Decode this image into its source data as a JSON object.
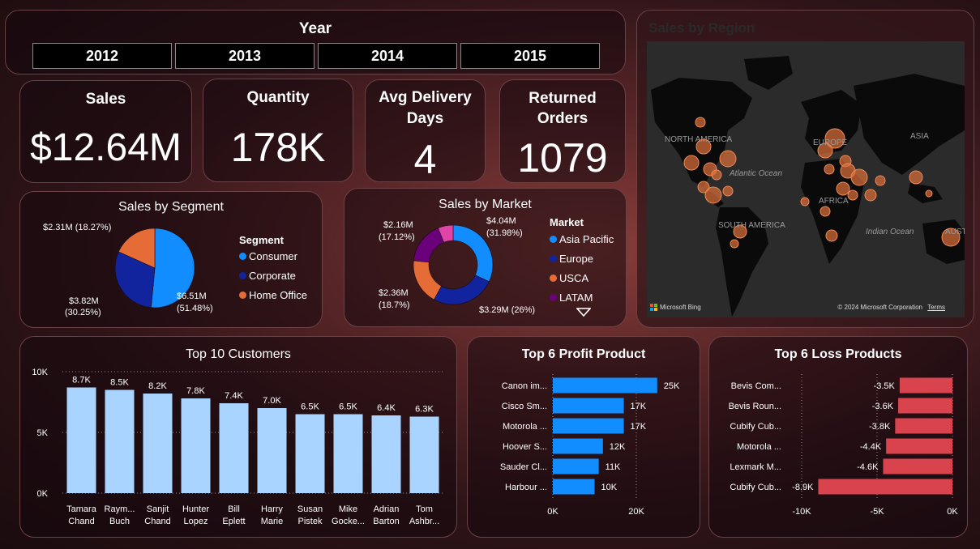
{
  "year_slicer": {
    "title": "Year",
    "years": [
      "2012",
      "2013",
      "2014",
      "2015"
    ]
  },
  "kpis": {
    "sales": {
      "title": "Sales",
      "value": "$12.64M"
    },
    "quantity": {
      "title": "Quantity",
      "value": "178K"
    },
    "avg_delivery": {
      "title_line1": "Avg Delivery",
      "title_line2": "Days",
      "value": "4"
    },
    "returned": {
      "title_line1": "Returned",
      "title_line2": "Orders",
      "value": "1079"
    }
  },
  "map": {
    "title": "Sales by Region",
    "labels": {
      "north_america": "NORTH AMERICA",
      "south_america": "SOUTH AMERICA",
      "europe": "EUROPE",
      "asia": "ASIA",
      "africa": "AFRICA",
      "australia": "AUSTRA",
      "atlantic": "Atlantic Ocean",
      "indian": "Indian Ocean"
    },
    "bing": "Microsoft Bing",
    "copyright": "© 2024 Microsoft Corporation",
    "terms": "Terms",
    "bubble_color": "#e0703a"
  },
  "colors": {
    "consumer": "#118dff",
    "corporate": "#12239e",
    "home_office": "#e66c37",
    "latam": "#6b007b",
    "other": "#e044a7",
    "customers_bar": "#a8d4ff",
    "profit_bar": "#118dff",
    "loss_bar": "#d9434e"
  },
  "chart_data": [
    {
      "type": "pie",
      "title": "Sales by Segment",
      "legend_title": "Segment",
      "slices": [
        {
          "name": "Consumer",
          "value": 6.51,
          "label": "$6.51M",
          "pct": "(51.48%)"
        },
        {
          "name": "Corporate",
          "value": 3.82,
          "label": "$3.82M",
          "pct": "(30.25%)"
        },
        {
          "name": "Home Office",
          "value": 2.31,
          "label": "$2.31M (18.27%)"
        }
      ]
    },
    {
      "type": "pie",
      "title": "Sales by Market",
      "legend_title": "Market",
      "legend": [
        "Asia Pacific",
        "Europe",
        "USCA",
        "LATAM"
      ],
      "slices": [
        {
          "value": 31.98,
          "label": "$4.04M",
          "pct": "(31.98%)"
        },
        {
          "value": 26.0,
          "label": "$3.29M (26%)"
        },
        {
          "value": 18.7,
          "label": "$2.36M",
          "pct": "(18.7%)"
        },
        {
          "value": 17.12,
          "label": "$2.16M",
          "pct": "(17.12%)"
        },
        {
          "value": 6.2
        }
      ]
    },
    {
      "type": "bar",
      "title": "Top 10 Customers",
      "categories": [
        "Tamara Chand",
        "Raymond Buch",
        "Sanjit Chand",
        "Hunter Lopez",
        "Bill Eplett",
        "Harry Marie",
        "Susan Pistek",
        "Mike Gockenbach",
        "Adrian Barton",
        "Tom Ashbrook"
      ],
      "category_lines": [
        [
          "Tamara",
          "Chand"
        ],
        [
          "Raym...",
          "Buch"
        ],
        [
          "Sanjit",
          "Chand"
        ],
        [
          "Hunter",
          "Lopez"
        ],
        [
          "Bill",
          "Eplett"
        ],
        [
          "Harry",
          "Marie"
        ],
        [
          "Susan",
          "Pistek"
        ],
        [
          "Mike",
          "Gocke..."
        ],
        [
          "Adrian",
          "Barton"
        ],
        [
          "Tom",
          "Ashbr..."
        ]
      ],
      "values": [
        8.7,
        8.5,
        8.2,
        7.8,
        7.4,
        7.0,
        6.5,
        6.5,
        6.4,
        6.3
      ],
      "labels": [
        "8.7K",
        "8.5K",
        "8.2K",
        "7.8K",
        "7.4K",
        "7.0K",
        "6.5K",
        "6.5K",
        "6.4K",
        "6.3K"
      ],
      "yticks": [
        "0K",
        "5K",
        "10K"
      ],
      "ylim": [
        0,
        10
      ]
    },
    {
      "type": "bar",
      "title": "Top 6 Profit Product",
      "categories": [
        "Canon im...",
        "Cisco Sm...",
        "Motorola ...",
        "Hoover S...",
        "Sauder Cl...",
        "Harbour ..."
      ],
      "values": [
        25,
        17,
        17,
        12,
        11,
        10
      ],
      "labels": [
        "25K",
        "17K",
        "17K",
        "12K",
        "11K",
        "10K"
      ],
      "xticks": [
        "0K",
        "20K"
      ],
      "xlim": [
        0,
        20
      ]
    },
    {
      "type": "bar",
      "title": "Top 6 Loss Products",
      "categories": [
        "Bevis Com...",
        "Bevis Roun...",
        "Cubify Cub...",
        "Motorola ...",
        "Lexmark M...",
        "Cubify Cub..."
      ],
      "values": [
        -3.5,
        -3.6,
        -3.8,
        -4.4,
        -4.6,
        -8.9
      ],
      "labels": [
        "-3.5K",
        "-3.6K",
        "-3.8K",
        "-4.4K",
        "-4.6K",
        "-8.9K"
      ],
      "xticks": [
        "-10K",
        "-5K",
        "0K"
      ],
      "xlim": [
        -10,
        0
      ]
    }
  ]
}
